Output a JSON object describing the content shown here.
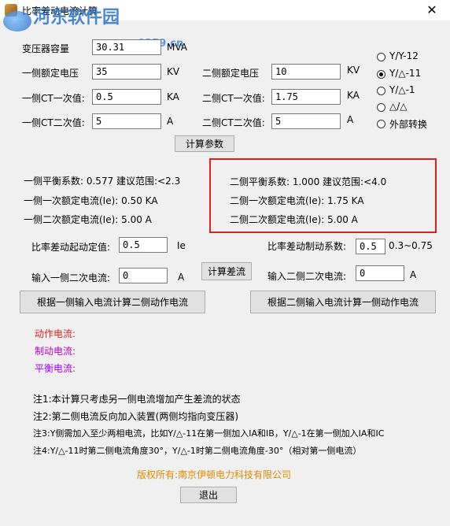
{
  "window": {
    "title": "比率差动电流计算",
    "close": "✕"
  },
  "watermark": {
    "site": "河东软件园",
    "url": "www.pc0359.cn"
  },
  "transformer": {
    "capacity_label": "变压器容量",
    "capacity_value": "30.31",
    "capacity_unit": "MVA"
  },
  "side1": {
    "rated_voltage_label": "一侧额定电压",
    "rated_voltage_value": "35",
    "rated_voltage_unit": "KV",
    "ct_primary_label": "一侧CT一次值:",
    "ct_primary_value": "0.5",
    "ct_primary_unit": "KA",
    "ct_secondary_label": "一侧CT二次值:",
    "ct_secondary_value": "5",
    "ct_secondary_unit": "A"
  },
  "side2": {
    "rated_voltage_label": "二侧额定电压",
    "rated_voltage_value": "10",
    "rated_voltage_unit": "KV",
    "ct_primary_label": "二侧CT一次值:",
    "ct_primary_value": "1.75",
    "ct_primary_unit": "KA",
    "ct_secondary_label": "二侧CT二次值:",
    "ct_secondary_value": "5",
    "ct_secondary_unit": "A"
  },
  "connection": {
    "options": [
      "Y/Y-12",
      "Y/△-11",
      "Y/△-1",
      "△/△",
      "外部转换"
    ],
    "selected": "Y/△-11"
  },
  "buttons": {
    "calc_params": "计算参数",
    "calc_diff": "计算差流",
    "calc_side2": "根据一侧输入电流计算二侧动作电流",
    "calc_side1": "根据二侧输入电流计算一侧动作电流",
    "exit": "退出"
  },
  "results_side1": {
    "balance": "一侧平衡系数:   0.577 建议范围:<2.3",
    "primary_rated": "一侧一次额定电流(Ie): 0.50 KA",
    "secondary_rated": "一侧二次额定电流(Ie): 5.00 A"
  },
  "results_side2": {
    "balance": "二侧平衡系数:   1.000 建议范围:<4.0",
    "primary_rated": "二侧一次额定电流(Ie): 1.75 KA",
    "secondary_rated": "二侧二次额定电流(Ie): 5.00 A"
  },
  "diff": {
    "start_label": "比率差动起动定值:",
    "start_value": "0.5",
    "start_unit": "Ie",
    "brake_label": "比率差动制动系数:",
    "brake_value": "0.5",
    "brake_range": "0.3~0.75",
    "input1_label": "输入一侧二次电流:",
    "input1_value": "0",
    "input1_unit": "A",
    "input2_label": "输入二侧二次电流:",
    "input2_value": "0",
    "input2_unit": "A"
  },
  "outputs": {
    "action_label": "动作电流:",
    "action_color": "#e02020",
    "brake_label": "制动电流:",
    "brake_color": "#c000c0",
    "balance_label": "平衡电流:",
    "balance_color": "#a000ff"
  },
  "notes": [
    "注1:本计算只考虑另一侧电流增加产生差流的状态",
    "注2:第二侧电流反向加入装置(两侧均指向变压器)",
    "注3:Y侧需加入至少两相电流，比如Y/△-11在第一侧加入IA和IB，Y/△-1在第一侧加入IA和IC",
    "注4:Y/△-11时第二侧电流角度30°，Y/△-1时第二侧电流角度-30°（相对第一侧电流）"
  ],
  "copyright": {
    "text": "版权所有:南京伊顿电力科技有限公司",
    "color": "#e08a00"
  }
}
